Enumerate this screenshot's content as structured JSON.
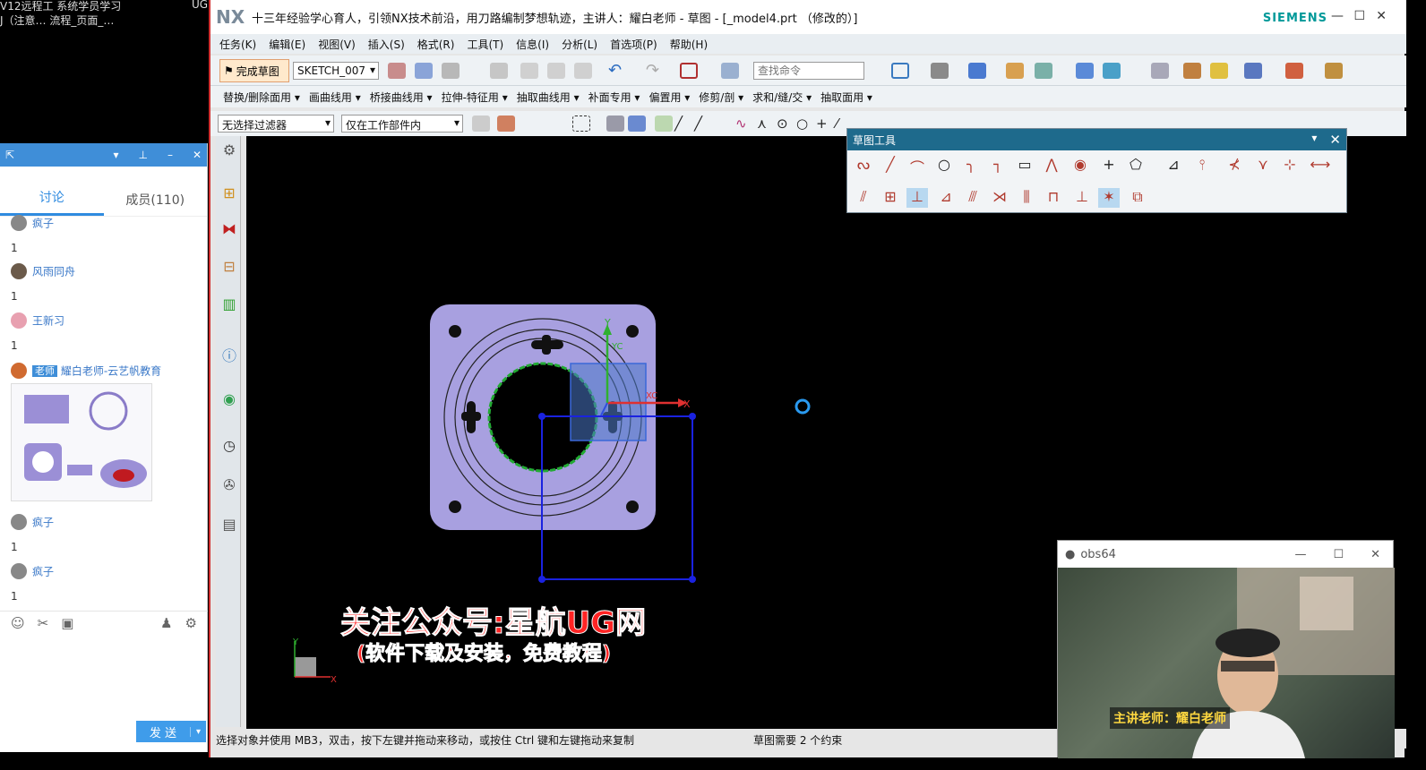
{
  "desktop": {
    "line1": "V12远程工  系统学员学习",
    "line2": "J（注意…  流程_页面_…",
    "corner": "UG"
  },
  "chat": {
    "tabs": [
      {
        "label": "讨论"
      },
      {
        "label": "成员(110)"
      }
    ],
    "messages": [
      {
        "name": "疯子",
        "text": "1"
      },
      {
        "name": "风雨同舟",
        "text": "1"
      },
      {
        "name": "王新习",
        "text": "1"
      },
      {
        "badge": "老师",
        "name": "耀白老师-云艺帆教育",
        "text": ""
      },
      {
        "name": "疯子",
        "text": "1"
      },
      {
        "name": "疯子",
        "text": "1"
      }
    ],
    "send_label": "发 送"
  },
  "nx": {
    "logo": "NX",
    "title": "十三年经验学心育人，引领NX技术前沿，用刀路编制梦想轨迹，主讲人：耀白老师 - 草图 - [_model4.prt （修改的）]",
    "brand": "SIEMENS",
    "menu": [
      "任务(K)",
      "编辑(E)",
      "视图(V)",
      "插入(S)",
      "格式(R)",
      "工具(T)",
      "信息(I)",
      "分析(L)",
      "首选项(P)",
      "帮助(H)"
    ],
    "finish_label": "完成草图",
    "sketch_name": "SKETCH_007",
    "find_placeholder": "查找命令",
    "toolbar2": [
      "替换/删除面用 ▾",
      "画曲线用 ▾",
      "桥接曲线用 ▾",
      "拉伸-特征用 ▾",
      "抽取曲线用 ▾",
      "补面专用 ▾",
      "偏置用 ▾",
      "修剪/剖 ▾",
      "求和/缝/交 ▾",
      "抽取面用 ▾"
    ],
    "filter": "无选择过滤器",
    "scope": "仅在工作部件内",
    "sketch_tools_title": "草图工具",
    "status_left": "选择对象并使用 MB3，双击，按下左键并拖动来移动，或按住 Ctrl 键和左键拖动来复制",
    "status_right": "草图需要 2 个约束",
    "axis": {
      "x": "X",
      "y": "Y",
      "xc": "XC",
      "yc": "YC"
    }
  },
  "watermark": {
    "line1": "关注公众号:星航UG网",
    "line2": "(软件下载及安装，免费教程)"
  },
  "obs": {
    "title": "obs64",
    "caption": "主讲老师：耀白老师"
  }
}
